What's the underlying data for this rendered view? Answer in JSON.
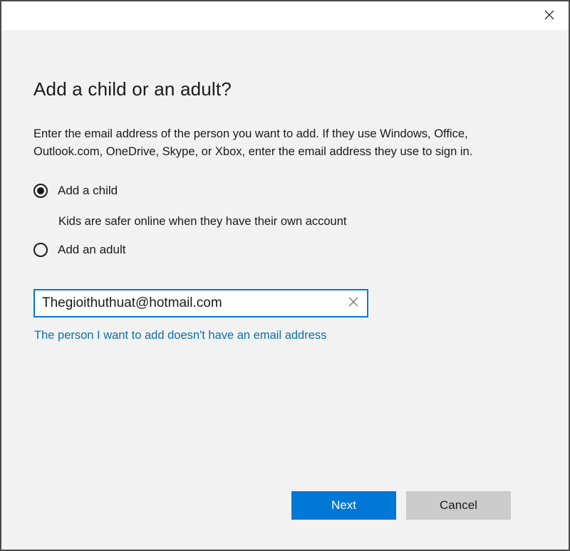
{
  "dialog": {
    "title": "Add a child or an adult?",
    "description": "Enter the email address of the person you want to add. If they use Windows, Office, Outlook.com, OneDrive, Skype, or Xbox, enter the email address they use to sign in.",
    "options": [
      {
        "label": "Add a child",
        "selected": true
      },
      {
        "label": "Add an adult",
        "selected": false
      }
    ],
    "child_helper": "Kids are safer online when they have their own account",
    "email": {
      "value": "Thegioithuthuat@hotmail.com"
    },
    "no_email_link": "The person I want to add doesn't have an email address",
    "buttons": {
      "next": "Next",
      "cancel": "Cancel"
    }
  },
  "icons": {
    "close": "close-icon",
    "clear": "clear-icon"
  },
  "colors": {
    "accent": "#0078d7",
    "link": "#0f6fa8",
    "background": "#f2f2f2",
    "cancel_button": "#cccccc"
  }
}
